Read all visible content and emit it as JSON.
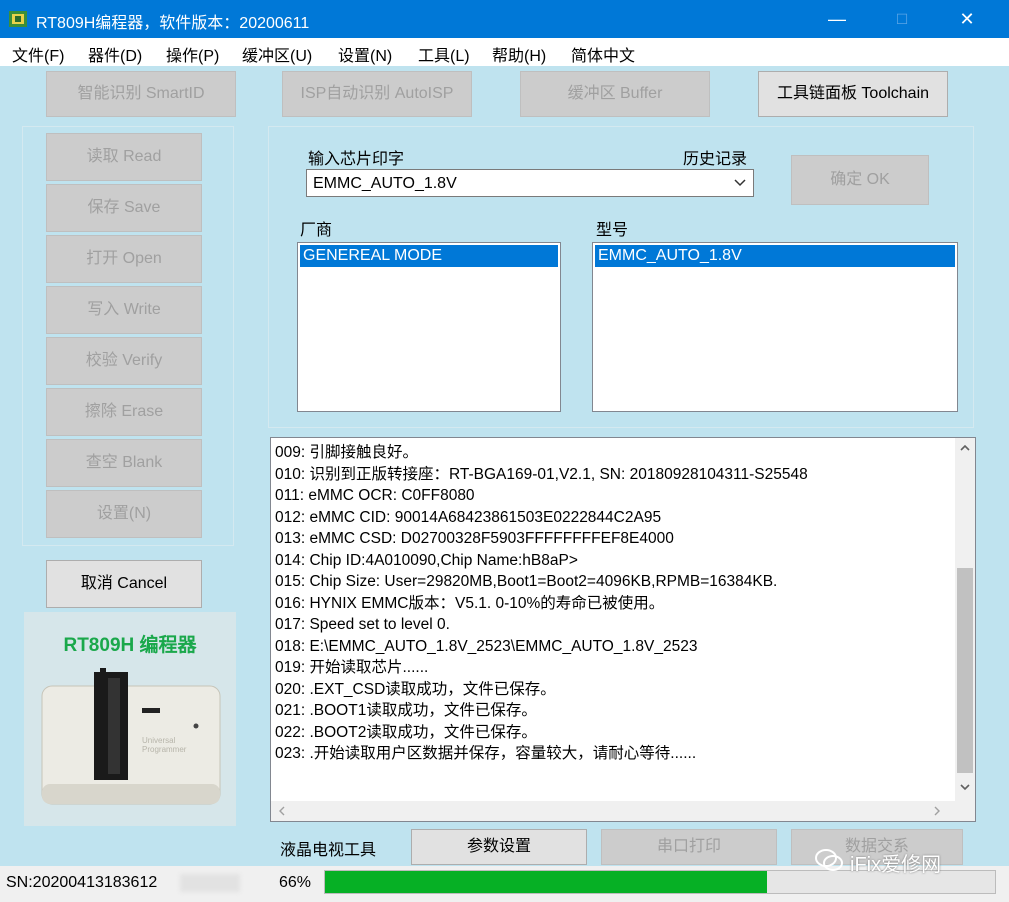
{
  "window": {
    "title": "RT809H编程器，软件版本：20200611",
    "min_glyph": "—",
    "max_glyph": "☐",
    "close_glyph": "✕"
  },
  "menu": [
    "文件(F)",
    "器件(D)",
    "操作(P)",
    "缓冲区(U)",
    "设置(N)",
    "工具(L)",
    "帮助(H)",
    "简体中文"
  ],
  "top_buttons": {
    "smartid": "智能识别 SmartID",
    "autoisp": "ISP自动识别 AutoISP",
    "buffer": "缓冲区 Buffer",
    "toolchain": "工具链面板 Toolchain"
  },
  "side_buttons": {
    "read": "读取 Read",
    "save": "保存 Save",
    "open": "打开 Open",
    "write": "写入 Write",
    "verify": "校验 Verify",
    "erase": "擦除 Erase",
    "blank": "查空 Blank",
    "settings": "设置(N)",
    "cancel": "取消 Cancel"
  },
  "product": {
    "caption": "RT809H 编程器",
    "device_text": "Universal Programmer"
  },
  "chip": {
    "input_label": "输入芯片印字",
    "history_label": "历史记录",
    "input_value": "EMMC_AUTO_1.8V",
    "ok_button": "确定 OK",
    "vendor_label": "厂商",
    "model_label": "型号",
    "vendor_selected": "GENEREAL MODE",
    "model_selected": "EMMC_AUTO_1.8V"
  },
  "log": [
    "009: 引脚接触良好。",
    "010: 识别到正版转接座：RT-BGA169-01,V2.1, SN: 20180928104311-S25548",
    "011: eMMC OCR: C0FF8080",
    "012: eMMC CID:  90014A68423861503E0222844C2A95",
    "013: eMMC CSD: D02700328F5903FFFFFFFFEF8E4000",
    "014: Chip ID:4A010090,Chip Name:hB8aP>",
    "015: Chip Size: User=29820MB,Boot1=Boot2=4096KB,RPMB=16384KB.",
    "016: HYNIX EMMC版本：V5.1.  0-10%的寿命已被使用。",
    "017: Speed set to level 0.",
    "018: E:\\EMMC_AUTO_1.8V_2523\\EMMC_AUTO_1.8V_2523",
    "019: 开始读取芯片......",
    "020: .EXT_CSD读取成功，文件已保存。",
    "021: .BOOT1读取成功，文件已保存。",
    "022: .BOOT2读取成功，文件已保存。",
    "023: .开始读取用户区数据并保存，容量较大，请耐心等待......"
  ],
  "tools": {
    "lcd_label": "液晶电视工具",
    "params": "参数设置",
    "serial": "串口打印",
    "data": "数据交系"
  },
  "status": {
    "sn": "SN:20200413183612",
    "percent": "66%",
    "progress": 0.66
  },
  "watermark": "iFix爱修网",
  "colors": {
    "accent": "#0078d7",
    "background": "#bfe3ef",
    "progress": "#06b025"
  }
}
